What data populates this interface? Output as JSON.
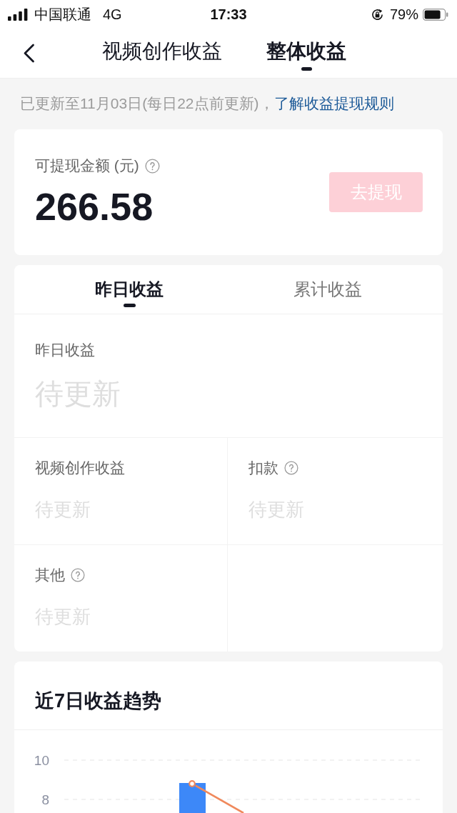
{
  "status_bar": {
    "carrier": "中国联通",
    "network": "4G",
    "time": "17:33",
    "battery": "79%"
  },
  "nav": {
    "tabs": [
      {
        "label": "视频创作收益",
        "selected": false
      },
      {
        "label": "整体收益",
        "selected": true
      }
    ]
  },
  "update_notice": {
    "text": "已更新至11月03日(每日22点前更新)，",
    "link": "了解收益提现规则"
  },
  "balance_card": {
    "label": "可提现金额 (元)",
    "help": true,
    "amount": "266.58",
    "button": {
      "label": "去提现",
      "disabled": true
    }
  },
  "earnings_card": {
    "tabs": [
      {
        "label": "昨日收益",
        "selected": true
      },
      {
        "label": "累计收益",
        "selected": false
      }
    ],
    "total": {
      "label": "昨日收益",
      "value": "待更新"
    },
    "items": [
      {
        "label": "视频创作收益",
        "help": false,
        "value": "待更新"
      },
      {
        "label": "扣款",
        "help": true,
        "value": "待更新"
      },
      {
        "label": "其他",
        "help": true,
        "value": "待更新"
      }
    ]
  },
  "trend_card": {
    "title": "近7日收益趋势",
    "y_axis_labels": [
      "10",
      "8"
    ]
  }
}
